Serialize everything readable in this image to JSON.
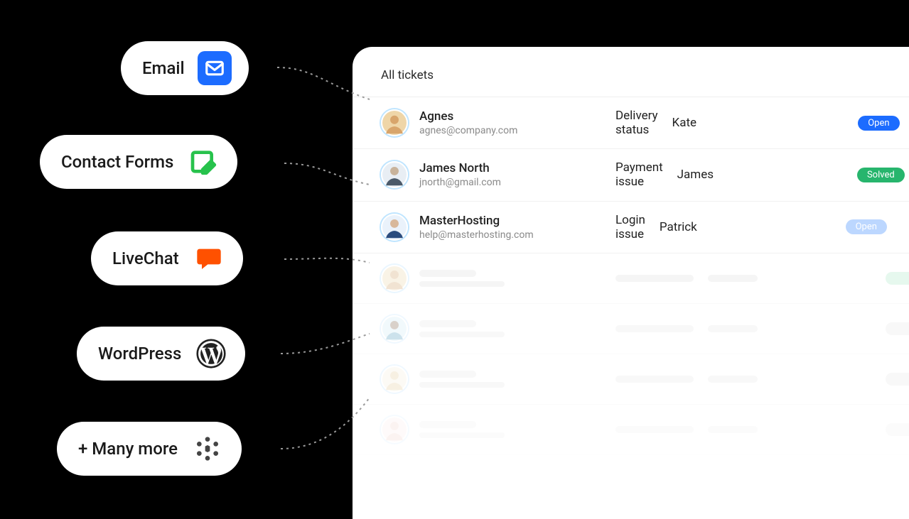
{
  "sources": [
    {
      "label": "Email",
      "icon": "email"
    },
    {
      "label": "Contact Forms",
      "icon": "form"
    },
    {
      "label": "LiveChat",
      "icon": "livechat"
    },
    {
      "label": "WordPress",
      "icon": "wordpress"
    },
    {
      "label": "+ Many more",
      "icon": "more"
    }
  ],
  "panel": {
    "title": "All tickets"
  },
  "tickets": [
    {
      "name": "Agnes",
      "email": "agnes@company.com",
      "subject": "Delivery status",
      "assignee": "Kate",
      "status": "Open",
      "status_style": "open"
    },
    {
      "name": "James North",
      "email": "jnorth@gmail.com",
      "subject": "Payment issue",
      "assignee": "James",
      "status": "Solved",
      "status_style": "solved"
    },
    {
      "name": "MasterHosting",
      "email": "help@masterhosting.com",
      "subject": "Login issue",
      "assignee": "Patrick",
      "status": "Open",
      "status_style": "open-muted"
    }
  ]
}
